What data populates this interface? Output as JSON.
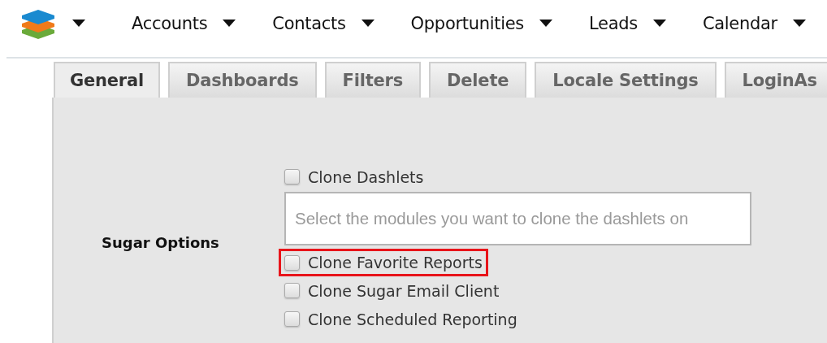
{
  "nav": {
    "items": [
      {
        "label": "Accounts"
      },
      {
        "label": "Contacts"
      },
      {
        "label": "Opportunities"
      },
      {
        "label": "Leads"
      },
      {
        "label": "Calendar"
      }
    ]
  },
  "tabs": [
    {
      "label": "General",
      "selected": true
    },
    {
      "label": "Dashboards",
      "selected": false
    },
    {
      "label": "Filters",
      "selected": false
    },
    {
      "label": "Delete",
      "selected": false
    },
    {
      "label": "Locale Settings",
      "selected": false
    },
    {
      "label": "LoginAs",
      "selected": false
    }
  ],
  "section": {
    "label": "Sugar Options",
    "options": [
      {
        "kind": "checkbox",
        "label": "Clone Dashlets",
        "checked": false,
        "highlighted": false
      },
      {
        "kind": "field",
        "placeholder": "Select the modules you want to clone the dashlets on"
      },
      {
        "kind": "checkbox",
        "label": "Clone Favorite Reports",
        "checked": false,
        "highlighted": true
      },
      {
        "kind": "checkbox",
        "label": "Clone Sugar Email Client",
        "checked": false,
        "highlighted": false
      },
      {
        "kind": "checkbox",
        "label": "Clone Scheduled Reporting",
        "checked": false,
        "highlighted": false
      }
    ]
  }
}
